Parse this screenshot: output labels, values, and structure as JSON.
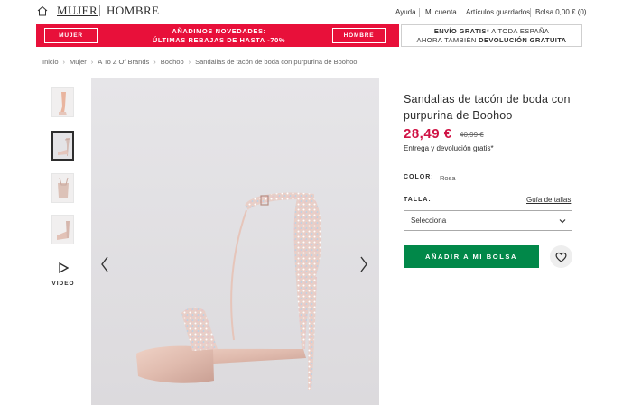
{
  "header": {
    "nav": {
      "women": "MUJER",
      "men": "HOMBRE"
    },
    "utility": {
      "help": "Ayuda",
      "account": "Mi cuenta",
      "saved": "Artículos guardados",
      "bag": "Bolsa 0,00 € (0)"
    }
  },
  "promo": {
    "left_button": "MUJER",
    "right_button": "HOMBRE",
    "headline_line1": "AÑADIMOS NOVEDADES:",
    "headline_line2": "ÚLTIMAS REBAJAS DE HASTA -70%",
    "shipping_bold": "ENVÍO GRATIS",
    "shipping_rest": "* A TODA ESPAÑA",
    "returns_pre": "AHORA TAMBIÉN ",
    "returns_bold": "DEVOLUCIÓN GRATUITA"
  },
  "breadcrumb": [
    "Inicio",
    "Mujer",
    "A To Z Of Brands",
    "Boohoo",
    "Sandalias de tacón de boda con purpurina de Boohoo"
  ],
  "gallery": {
    "video_label": "VIDEO",
    "thumbnails": [
      "thumbnail-1",
      "thumbnail-2",
      "thumbnail-3",
      "thumbnail-4"
    ]
  },
  "product": {
    "title": "Sandalias de tacón de boda con purpurina de Boohoo",
    "price_current": "28,49 €",
    "price_original": "40,99 €",
    "delivery_link": "Entrega y devolución gratis*",
    "color_label": "COLOR:",
    "color_value": "Rosa",
    "size_label": "TALLA:",
    "size_guide": "Guía de tallas",
    "size_select_value": "Selecciona",
    "add_to_bag": "AÑADIR A MI BOLSA"
  },
  "colors": {
    "promo_red": "#e8103a",
    "price_red": "#d01345",
    "add_green": "#018849"
  },
  "icons": [
    "home-icon",
    "play-icon",
    "chevron-left-icon",
    "chevron-right-icon",
    "chevron-down-icon",
    "heart-icon"
  ]
}
